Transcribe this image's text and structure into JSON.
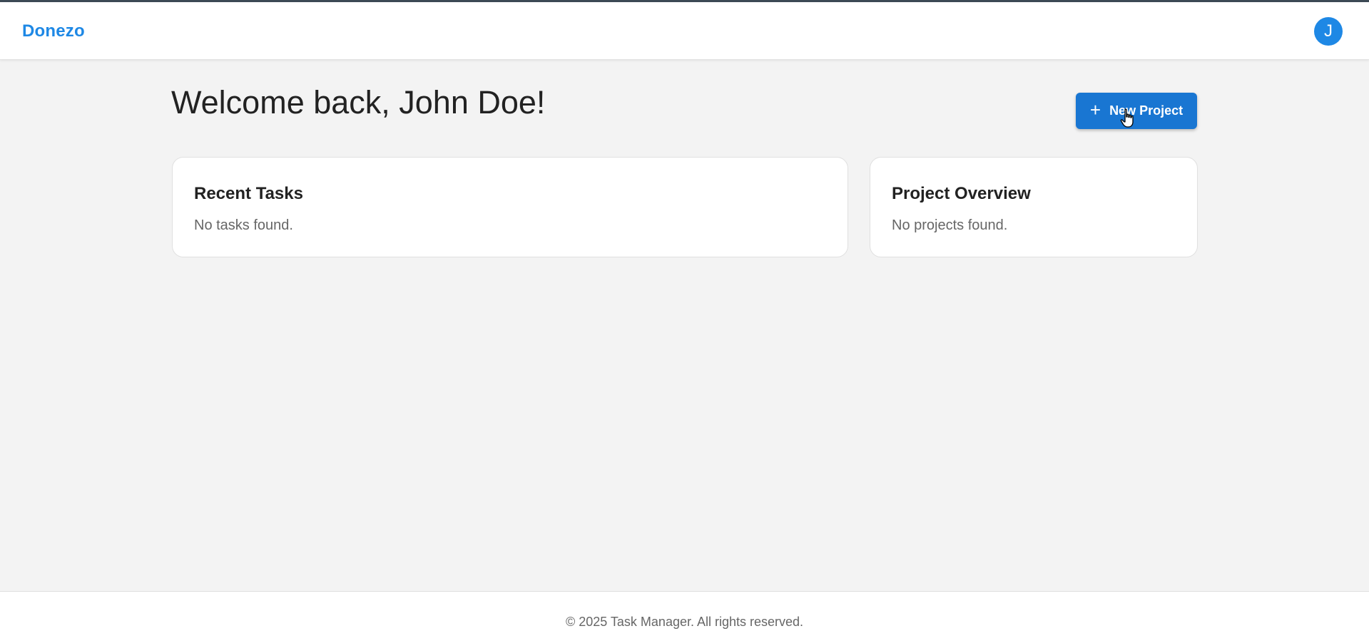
{
  "header": {
    "brand": "Donezo",
    "avatar_initial": "J"
  },
  "main": {
    "welcome": "Welcome back, John Doe!",
    "new_project_label": "New Project",
    "recent_tasks": {
      "title": "Recent Tasks",
      "empty_text": "No tasks found."
    },
    "project_overview": {
      "title": "Project Overview",
      "empty_text": "No projects found."
    }
  },
  "footer": {
    "text": "© 2025 Task Manager. All rights reserved."
  },
  "icons": {
    "plus": "plus-icon",
    "cursor": "hand-pointer-icon"
  },
  "colors": {
    "brand": "#1e88e5",
    "button": "#1976d2",
    "background": "#f3f3f3"
  }
}
